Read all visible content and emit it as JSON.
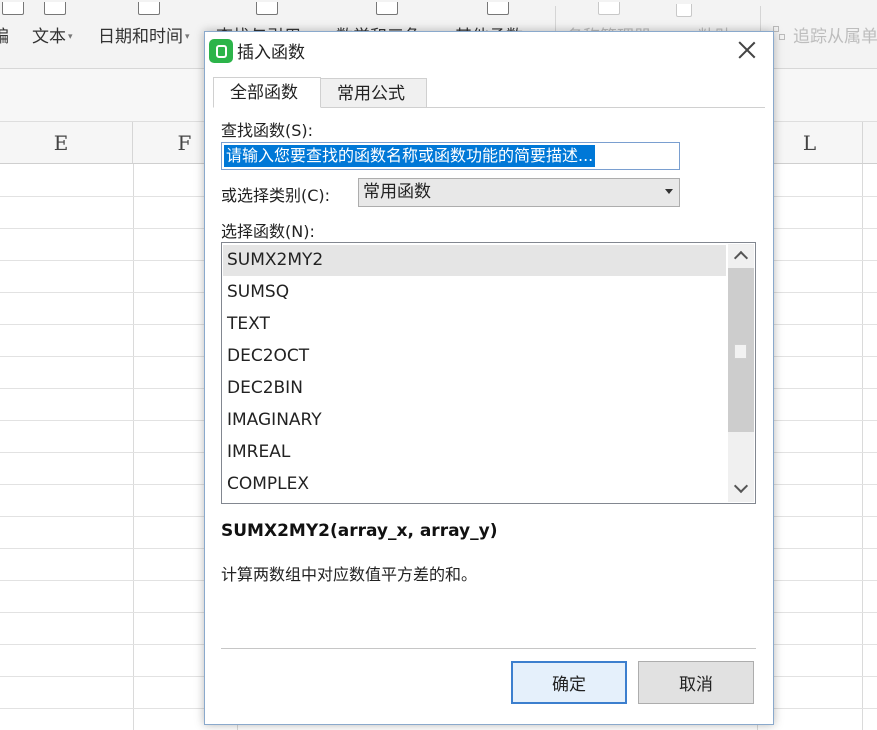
{
  "ribbon": {
    "buttons": [
      {
        "label": "编",
        "disabled": false
      },
      {
        "label": "文本",
        "disabled": false
      },
      {
        "label": "日期和时间",
        "disabled": false
      },
      {
        "label": "查找与引用",
        "disabled": false
      },
      {
        "label": "数学和三角",
        "disabled": false
      },
      {
        "label": "其他函数",
        "disabled": false
      },
      {
        "label": "名称管理器",
        "disabled": true
      },
      {
        "label": "粘贴",
        "disabled": true
      }
    ],
    "trace_dependents": "追踪从属单"
  },
  "sheet": {
    "columns": [
      "E",
      "F",
      "L"
    ]
  },
  "dialog": {
    "title": "插入函数",
    "tabs": [
      {
        "label": "全部函数",
        "active": true
      },
      {
        "label": "常用公式",
        "active": false
      }
    ],
    "search": {
      "label": "查找函数(S):",
      "value": "请输入您要查找的函数名称或函数功能的简要描述..."
    },
    "category": {
      "label": "或选择类别(C):",
      "selected": "常用函数"
    },
    "function_list": {
      "label": "选择函数(N):",
      "items": [
        "SUMX2MY2",
        "SUMSQ",
        "TEXT",
        "DEC2OCT",
        "DEC2BIN",
        "IMAGINARY",
        "IMREAL",
        "COMPLEX"
      ],
      "selected_index": 0
    },
    "syntax": "SUMX2MY2(array_x, array_y)",
    "description": "计算两数组中对应数值平方差的和。",
    "ok_label": "确定",
    "cancel_label": "取消"
  },
  "colors": {
    "selection": "#0078d7",
    "ok_border": "#3c7fce",
    "logo": "#2cb44a"
  }
}
